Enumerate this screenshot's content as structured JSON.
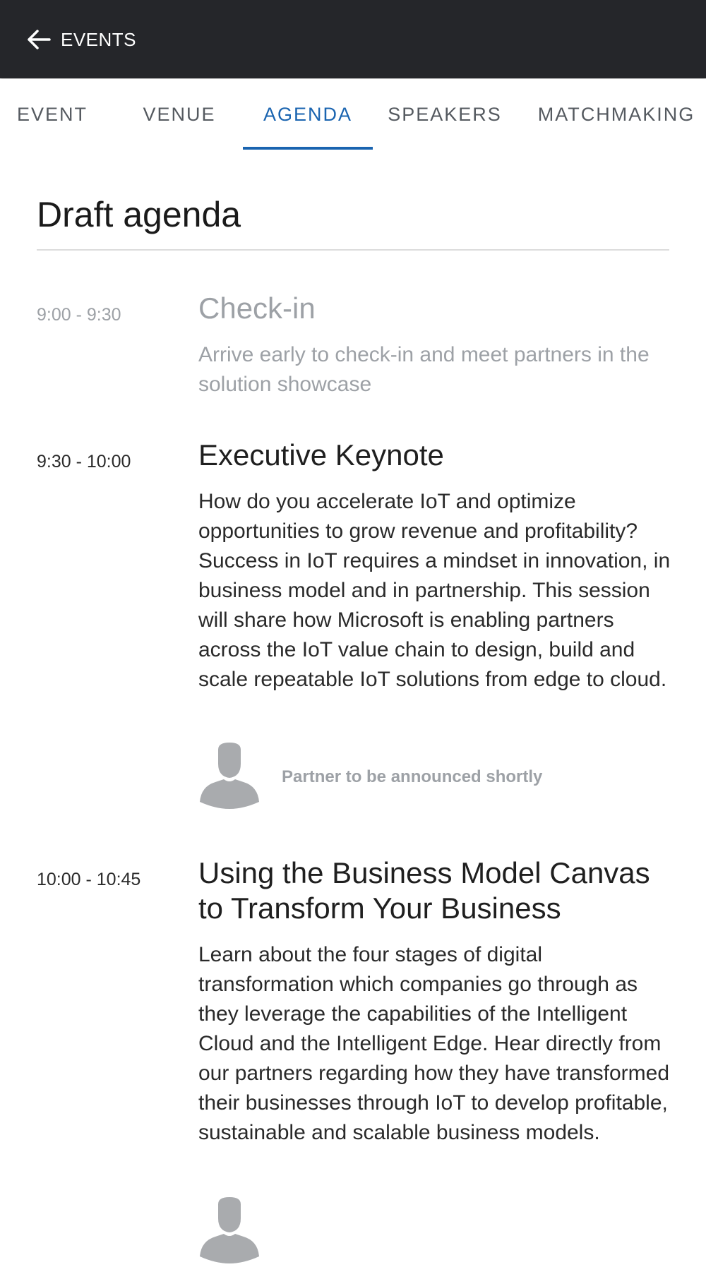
{
  "header": {
    "back_label": "EVENTS"
  },
  "tabs": [
    {
      "label": "EVENT"
    },
    {
      "label": "VENUE"
    },
    {
      "label": "AGENDA"
    },
    {
      "label": "SPEAKERS"
    },
    {
      "label": "MATCHMAKING"
    }
  ],
  "active_tab": "AGENDA",
  "page": {
    "title": "Draft agenda"
  },
  "sessions": [
    {
      "time": "9:00 - 9:30",
      "title": "Check-in",
      "description": "Arrive early to check-in and meet partners in the solution showcase"
    },
    {
      "time": "9:30 - 10:00",
      "title": "Executive Keynote",
      "description": "How do you accelerate IoT and optimize opportunities to grow revenue and profitability? Success in IoT requires a mindset in innovation, in business model and in partnership. This session will share how Microsoft is enabling partners across the IoT value chain to design, build and scale repeatable IoT solutions from edge to cloud.",
      "speaker": "Partner to be announced shortly"
    },
    {
      "time": "10:00 - 10:45",
      "title": "Using the Business Model Canvas to Transform Your Business",
      "description": "Learn about the four stages of digital transformation which companies go through as they leverage the capabilities of the Intelligent Cloud and the Intelligent Edge. Hear directly from our partners regarding how they have transformed their businesses through IoT to develop profitable, sustainable and scalable business models."
    }
  ],
  "colors": {
    "header_bg": "#25262a",
    "accent": "#1a64b0",
    "muted_text": "#9da1a6",
    "avatar": "#a9abae"
  },
  "icons": {
    "back": "arrow-left-icon",
    "avatar": "person-placeholder-icon"
  }
}
